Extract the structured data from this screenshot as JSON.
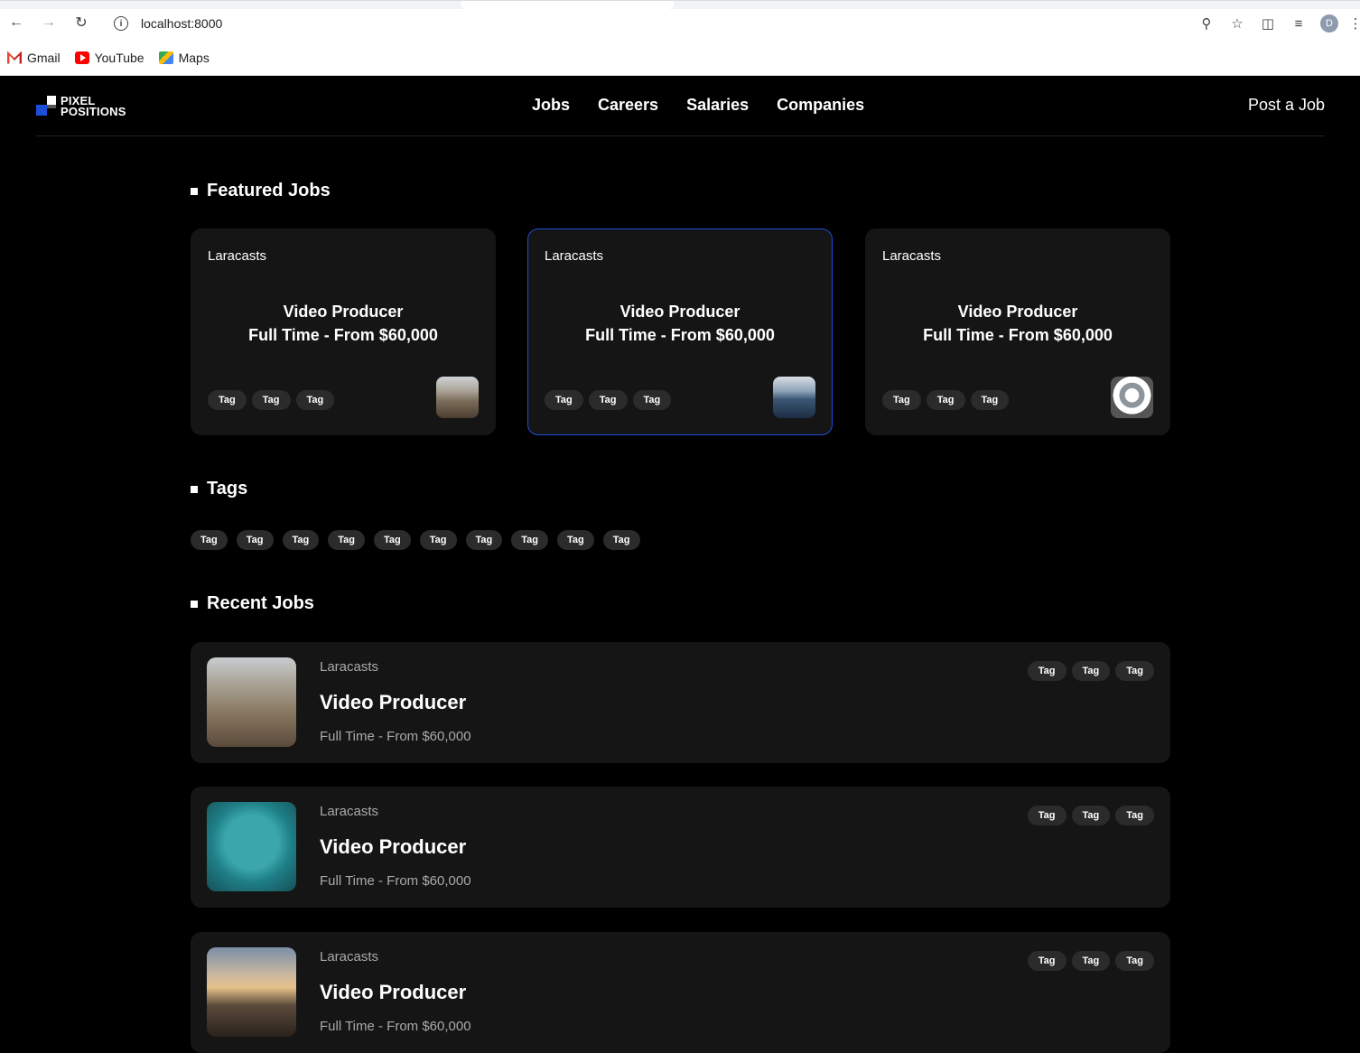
{
  "browser": {
    "url": "localhost:8000",
    "avatar_letter": "D",
    "bookmarks": [
      {
        "label": "Gmail",
        "icon": "gmail-icon"
      },
      {
        "label": "YouTube",
        "icon": "youtube-icon"
      },
      {
        "label": "Maps",
        "icon": "maps-icon"
      }
    ]
  },
  "header": {
    "logo_line1": "PIXEL",
    "logo_line2": "POSITIONS",
    "nav": [
      "Jobs",
      "Careers",
      "Salaries",
      "Companies"
    ],
    "post_job": "Post a Job"
  },
  "featured": {
    "heading": "Featured Jobs",
    "jobs": [
      {
        "company": "Laracasts",
        "title": "Video Producer",
        "subtitle": "Full Time - From $60,000",
        "tags": [
          "Tag",
          "Tag",
          "Tag"
        ],
        "image": "city-skyline"
      },
      {
        "company": "Laracasts",
        "title": "Video Producer",
        "subtitle": "Full Time - From $60,000",
        "tags": [
          "Tag",
          "Tag",
          "Tag"
        ],
        "image": "ocean"
      },
      {
        "company": "Laracasts",
        "title": "Video Producer",
        "subtitle": "Full Time - From $60,000",
        "tags": [
          "Tag",
          "Tag",
          "Tag"
        ],
        "image": "architecture"
      }
    ]
  },
  "tags": {
    "heading": "Tags",
    "items": [
      "Tag",
      "Tag",
      "Tag",
      "Tag",
      "Tag",
      "Tag",
      "Tag",
      "Tag",
      "Tag",
      "Tag"
    ]
  },
  "recent": {
    "heading": "Recent Jobs",
    "jobs": [
      {
        "company": "Laracasts",
        "title": "Video Producer",
        "meta": "Full Time - From $60,000",
        "tags": [
          "Tag",
          "Tag",
          "Tag"
        ],
        "image": "aerial-city"
      },
      {
        "company": "Laracasts",
        "title": "Video Producer",
        "meta": "Full Time - From $60,000",
        "tags": [
          "Tag",
          "Tag",
          "Tag"
        ],
        "image": "teal-water-boat"
      },
      {
        "company": "Laracasts",
        "title": "Video Producer",
        "meta": "Full Time - From $60,000",
        "tags": [
          "Tag",
          "Tag",
          "Tag"
        ],
        "image": "sunset-landscape"
      }
    ]
  },
  "colors": {
    "accent": "#1d4ed8",
    "card": "#151515",
    "background": "#000000"
  }
}
